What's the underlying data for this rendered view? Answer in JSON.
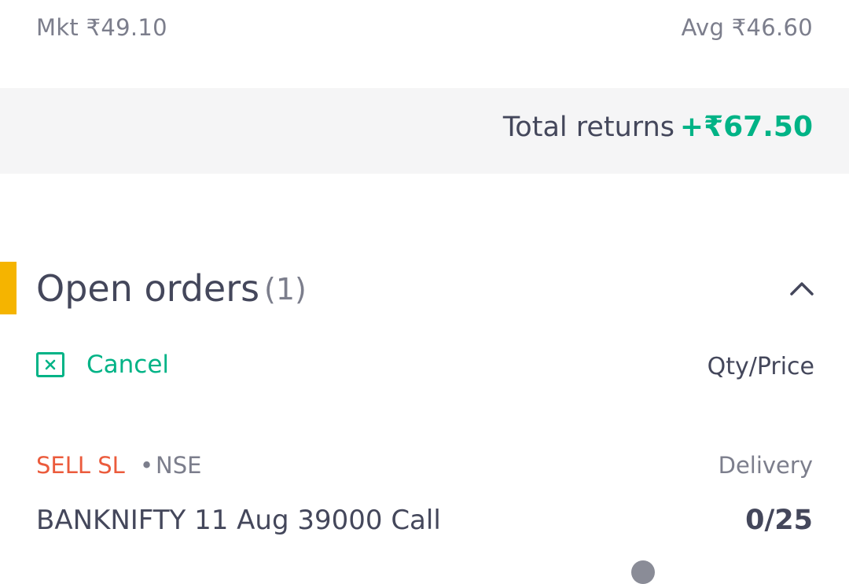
{
  "holding": {
    "market_price": "Mkt ₹49.10",
    "average_price": "Avg ₹46.60"
  },
  "returns": {
    "label": "Total returns",
    "value": "+₹67.50"
  },
  "open_orders": {
    "title": "Open orders",
    "count": "(1)",
    "collapse_icon": "chevron-up-icon",
    "cancel_label": "Cancel",
    "cancel_icon": "cancel-box-icon",
    "column_header": "Qty/Price",
    "orders": [
      {
        "side": "SELL SL",
        "separator": "•",
        "exchange": "NSE",
        "product": "Delivery",
        "instrument": "BANKNIFTY 11 Aug 39000 Call",
        "qty": "0/25"
      }
    ]
  },
  "colors": {
    "positive": "#00b386",
    "sell": "#eb5b3c",
    "accent": "#f5b400",
    "text_primary": "#44475b",
    "text_secondary": "#7c7e8c"
  }
}
